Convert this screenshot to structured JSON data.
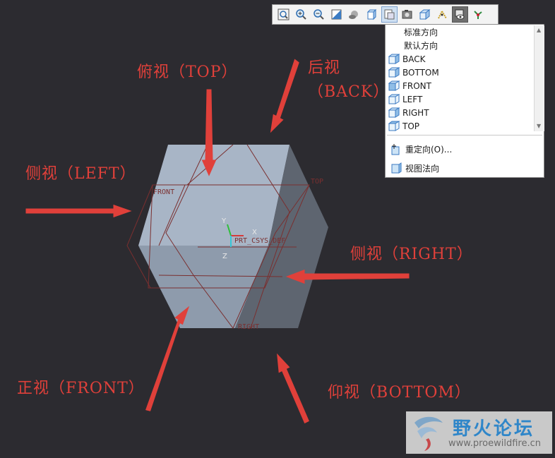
{
  "annotations": {
    "top": "俯视（TOP）",
    "back_line1": "后视",
    "back_line2": "（BACK）",
    "left": "侧视（LEFT）",
    "right": "侧视（RIGHT）",
    "front": "正视（FRONT）",
    "bottom": "仰视（BOTTOM）"
  },
  "model": {
    "datum_labels": {
      "front": "FRONT",
      "top": "TOP",
      "right": "RIGHT",
      "csys": "PRT_CSYS_DEF"
    },
    "axis_labels": {
      "x": "X",
      "y": "Y",
      "z": "Z"
    },
    "colors": {
      "background": "#2c2b30",
      "face_top": "#a8b5c6",
      "face_left": "#8e9bac",
      "face_right": "#5e6570",
      "datum_lines": "#7a2f2f",
      "annotation": "#e0403a"
    }
  },
  "toolbar": {
    "buttons": [
      {
        "name": "refit",
        "icon": "zoom-fit-icon"
      },
      {
        "name": "zoom-in",
        "icon": "zoom-in-icon"
      },
      {
        "name": "zoom-out",
        "icon": "zoom-out-icon"
      },
      {
        "name": "repaint",
        "icon": "repaint-icon"
      },
      {
        "name": "display-style",
        "icon": "display-style-icon"
      },
      {
        "name": "view-manager",
        "icon": "view-manager-icon"
      },
      {
        "name": "saved-views",
        "icon": "saved-views-icon",
        "active": true
      },
      {
        "name": "appearance",
        "icon": "camera-icon"
      },
      {
        "name": "perspective",
        "icon": "perspective-icon"
      },
      {
        "name": "datum-display",
        "icon": "datum-display-icon"
      },
      {
        "name": "show-hide",
        "icon": "show-hide-icon"
      },
      {
        "name": "spin-center",
        "icon": "spin-center-icon"
      }
    ]
  },
  "view_menu": {
    "items": [
      {
        "label": "标准方向",
        "icon": ""
      },
      {
        "label": "默认方向",
        "icon": ""
      },
      {
        "label": "BACK",
        "icon": "view-cube-icon"
      },
      {
        "label": "BOTTOM",
        "icon": "view-cube-icon"
      },
      {
        "label": "FRONT",
        "icon": "view-cube-icon"
      },
      {
        "label": "LEFT",
        "icon": "view-cube-icon"
      },
      {
        "label": "RIGHT",
        "icon": "view-cube-icon"
      },
      {
        "label": "TOP",
        "icon": "view-cube-icon"
      }
    ],
    "reorient": "重定向(O)...",
    "normal": "视图法向"
  },
  "watermark": {
    "title": "野火论坛",
    "url": "www.proewildfire.cn"
  }
}
